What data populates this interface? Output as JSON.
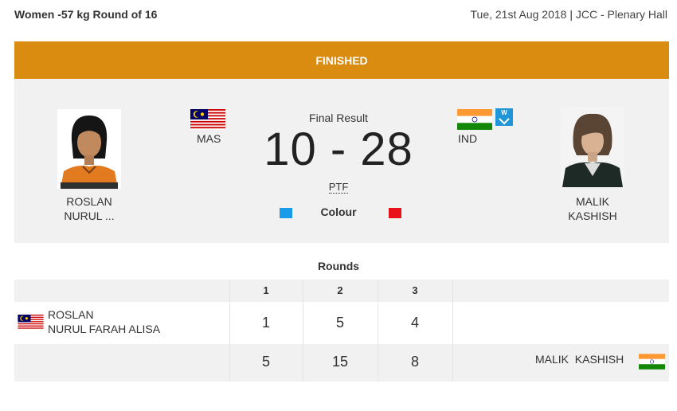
{
  "header": {
    "event": "Women -57 kg Round of 16",
    "date": "Tue, 21st Aug 2018",
    "separator": "|",
    "venue": "JCC - Plenary Hall"
  },
  "status": "FINISHED",
  "result": {
    "label": "Final Result",
    "score": "10 - 28",
    "method": "PTF",
    "colour_label": "Colour"
  },
  "blue_athlete": {
    "country_code": "MAS",
    "name_line1": "ROSLAN",
    "name_line2_short": "NURUL ...",
    "table_line1": "ROSLAN",
    "table_line2": "NURUL FARAH ALISA",
    "flag_icon": "malaysia-flag-icon",
    "colour": "#1a9bea"
  },
  "red_athlete": {
    "country_code": "IND",
    "name_line1": "MALIK",
    "name_line2": "KASHISH",
    "table_name": "MALIK  KASHISH",
    "flag_icon": "india-flag-icon",
    "badge": "W",
    "colour": "#e8131a"
  },
  "rounds": {
    "heading": "Rounds",
    "numbers": [
      "1",
      "2",
      "3"
    ],
    "blue_scores": [
      "1",
      "5",
      "4"
    ],
    "red_scores": [
      "5",
      "15",
      "8"
    ]
  },
  "colors": {
    "status_bar": "#d98c0f",
    "panel": "#f1f1f1",
    "badge": "#2196d6"
  }
}
